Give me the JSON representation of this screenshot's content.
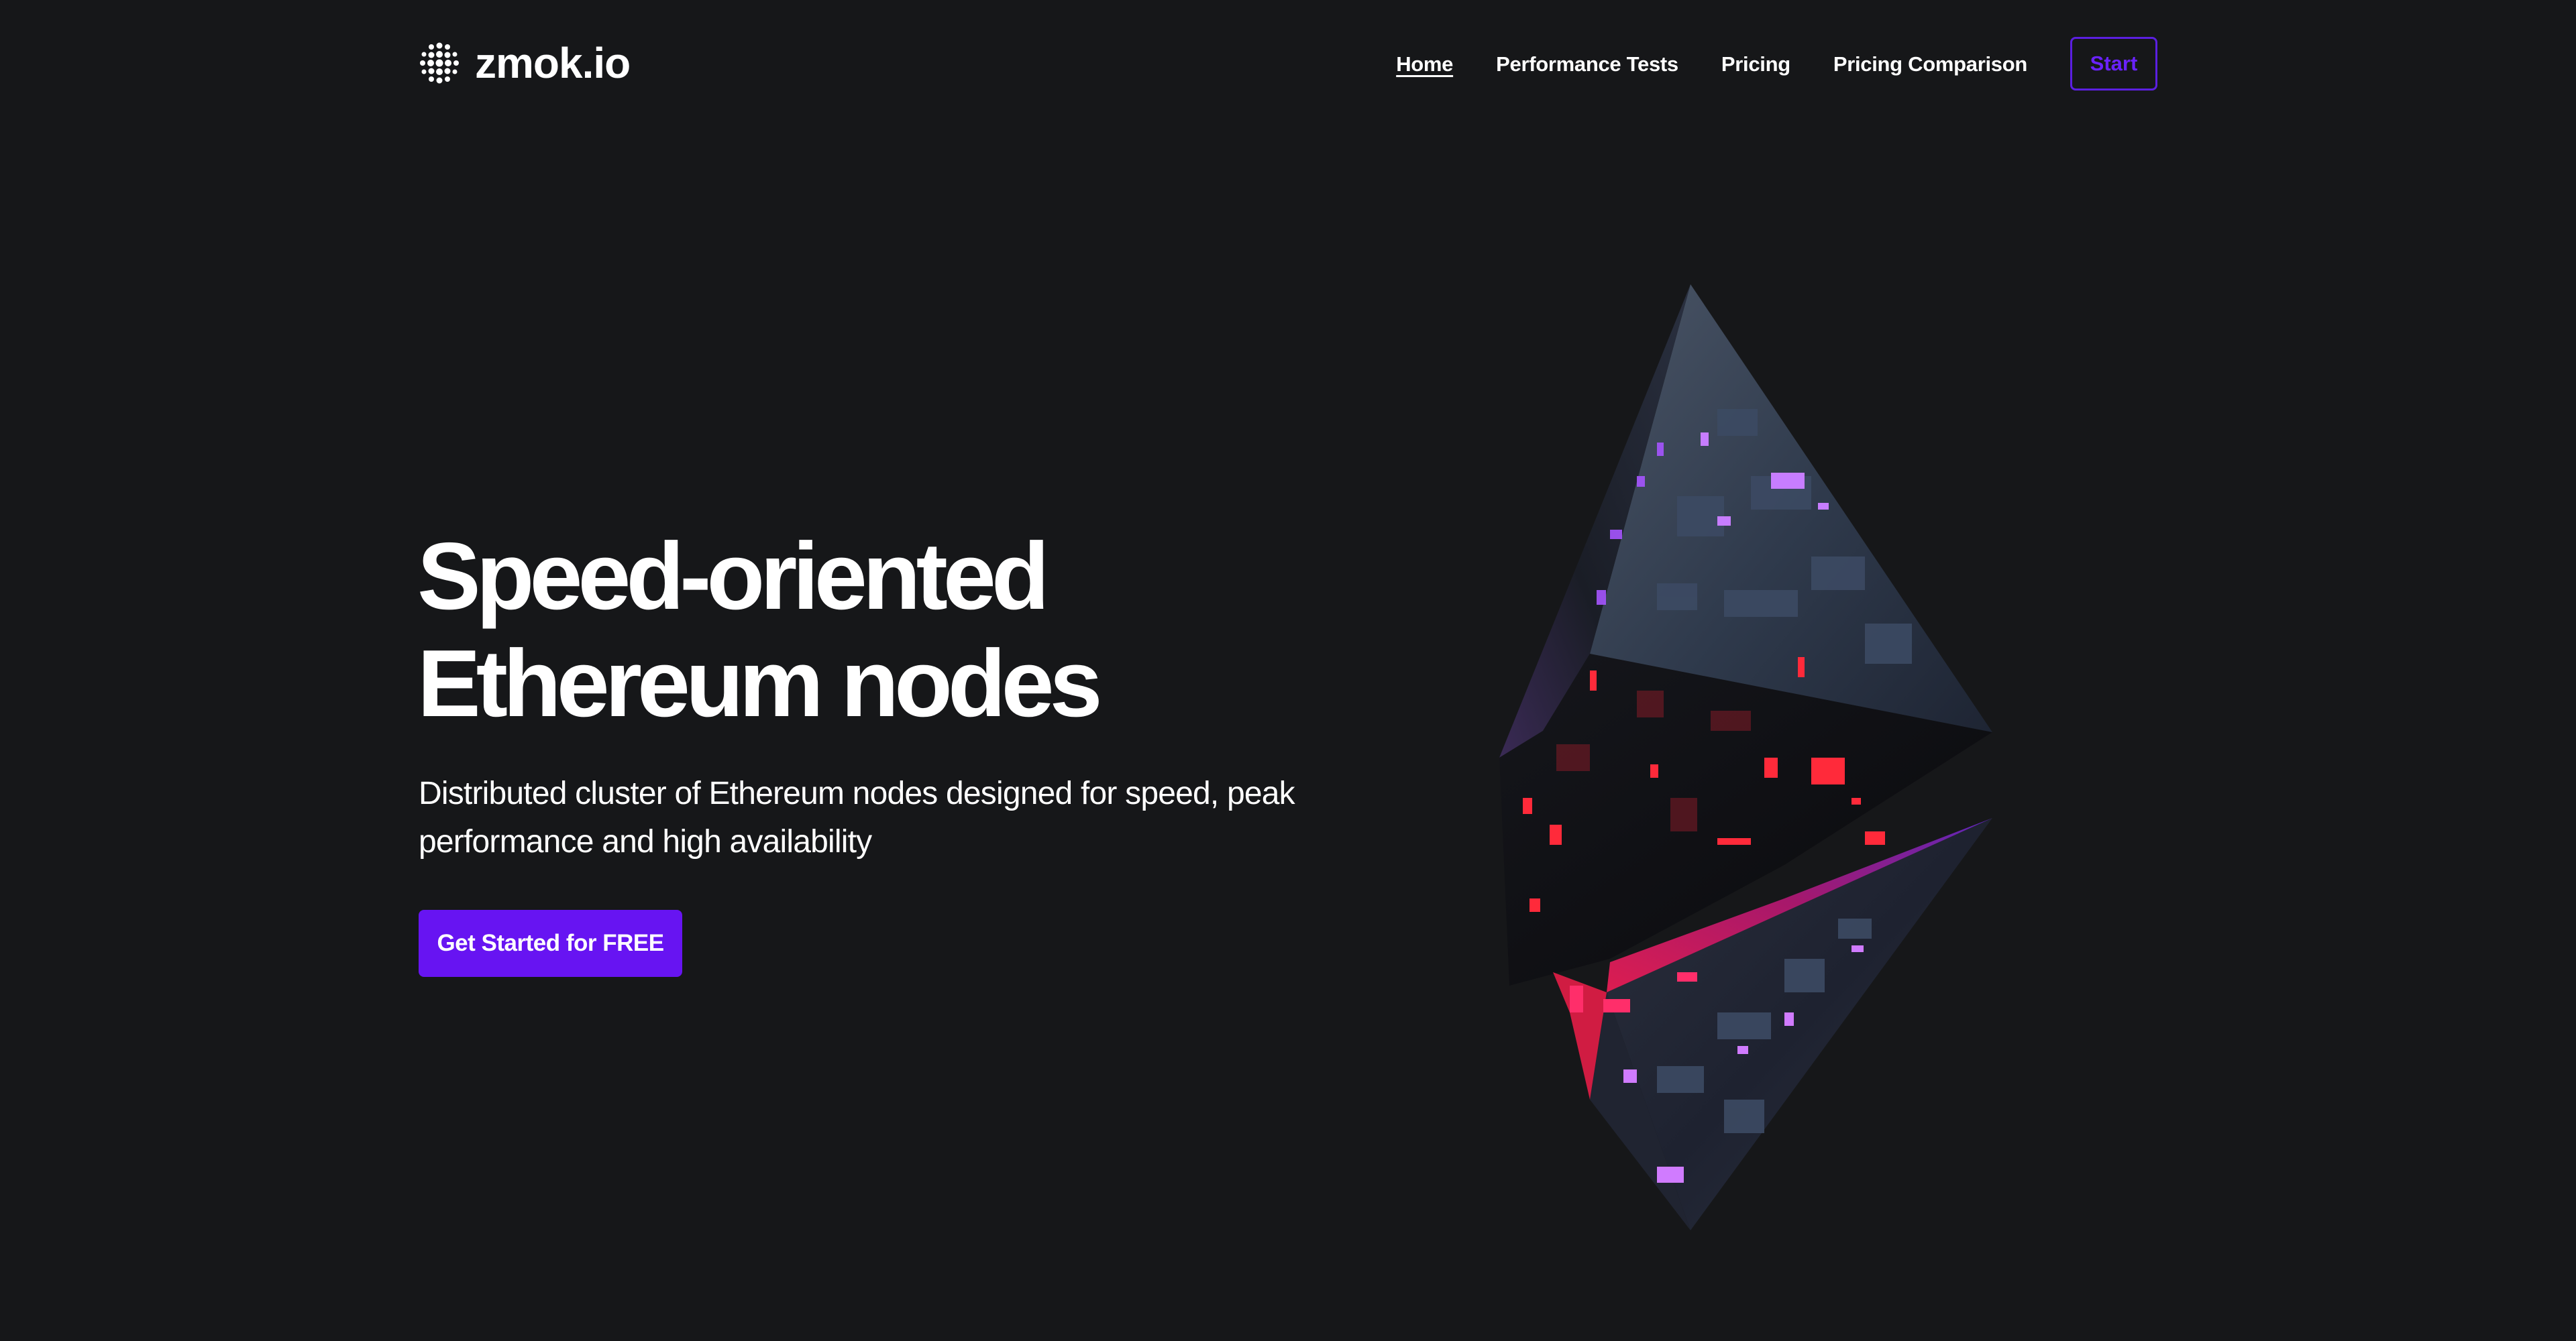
{
  "brand": {
    "name": "zmok.io",
    "logo_icon": "dot-grid-logo-icon"
  },
  "nav": {
    "items": [
      {
        "label": "Home",
        "active": true
      },
      {
        "label": "Performance Tests",
        "active": false
      },
      {
        "label": "Pricing",
        "active": false
      },
      {
        "label": "Pricing Comparison",
        "active": false
      }
    ],
    "start_label": "Start"
  },
  "hero": {
    "title_line1": "Speed-oriented",
    "title_line2": "Ethereum nodes",
    "subtitle": "Distributed cluster of Ethereum nodes designed for speed, peak performance and high availability",
    "cta_label": "Get Started for FREE",
    "art": "ethereum-crystal-illustration"
  },
  "colors": {
    "background": "#161719",
    "accent": "#6714f2",
    "accent_outline": "#5b1fe0",
    "text": "#ffffff"
  }
}
